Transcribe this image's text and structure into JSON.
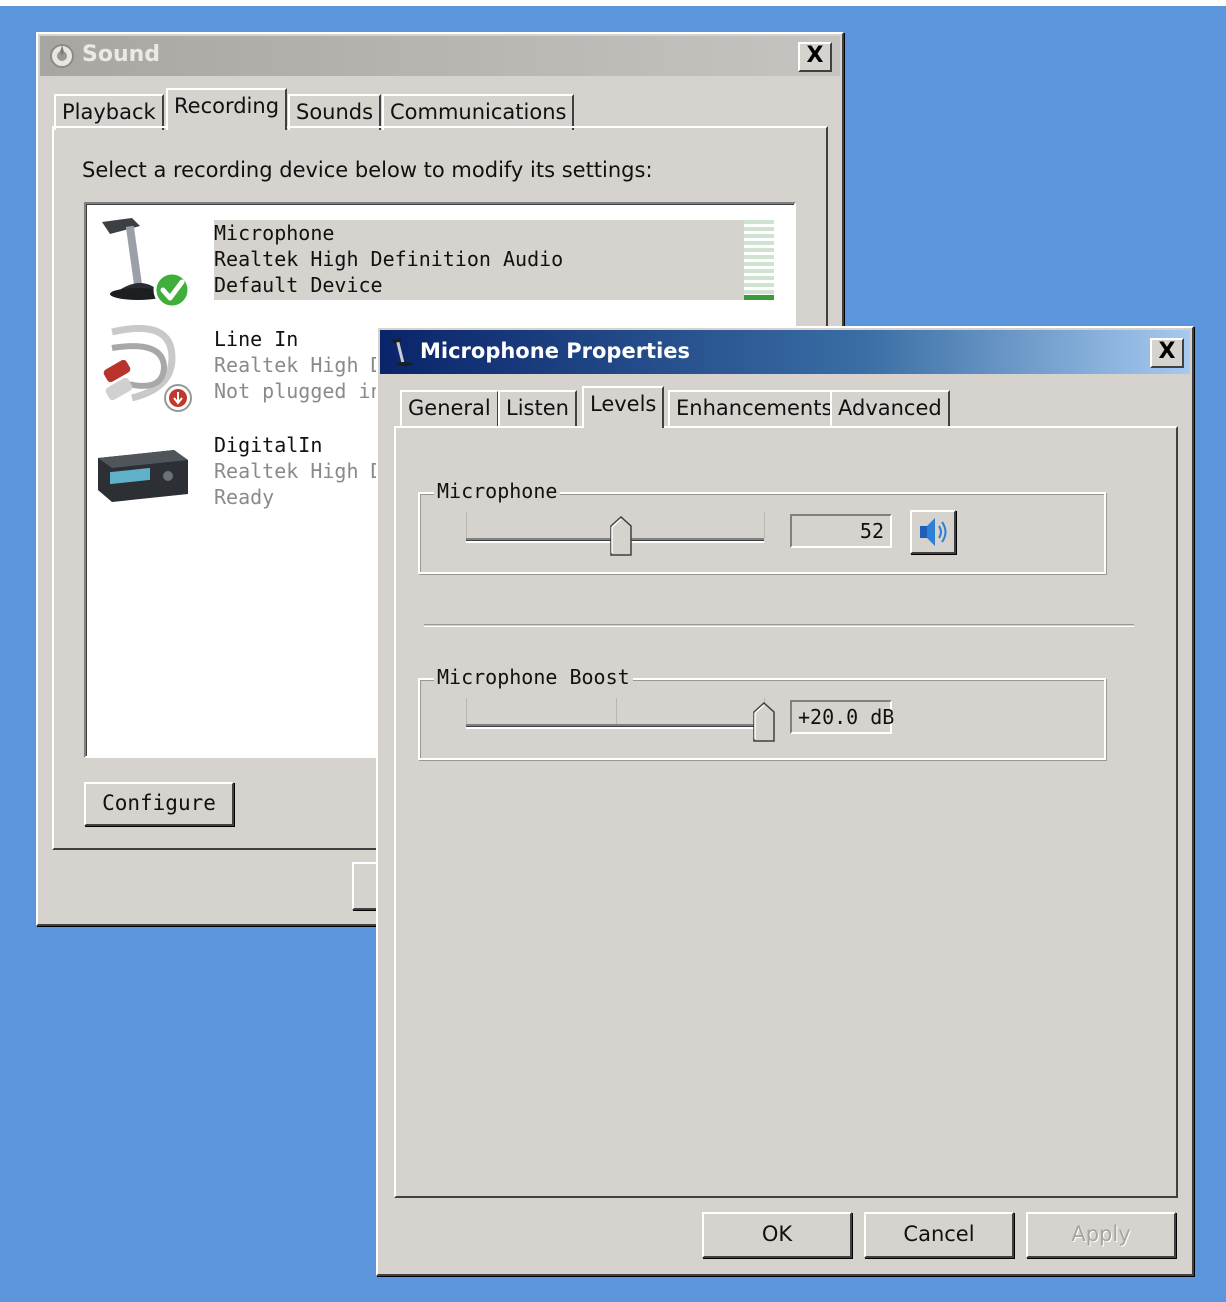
{
  "sound_window": {
    "title": "Sound",
    "close_label": "X",
    "tabs": [
      {
        "label": "Playback"
      },
      {
        "label": "Recording"
      },
      {
        "label": "Sounds"
      },
      {
        "label": "Communications"
      }
    ],
    "active_tab": "Recording",
    "instruction": "Select a recording device below to modify its settings:",
    "devices": [
      {
        "name": "Microphone",
        "driver": "Realtek High Definition Audio",
        "status": "Default Device",
        "icon": "microphone-icon",
        "selected": true
      },
      {
        "name": "Line In",
        "driver": "Realtek High De",
        "status": "Not plugged in",
        "icon": "line-in-cable-icon"
      },
      {
        "name": "DigitalIn",
        "driver": "Realtek High De",
        "status": "Ready",
        "icon": "digital-in-device-icon"
      }
    ],
    "configure_label": "Configure"
  },
  "mic_properties": {
    "title": "Microphone Properties",
    "close_label": "X",
    "tabs": [
      {
        "label": "General"
      },
      {
        "label": "Listen"
      },
      {
        "label": "Levels"
      },
      {
        "label": "Enhancements"
      },
      {
        "label": "Advanced"
      }
    ],
    "active_tab": "Levels",
    "microphone_group": {
      "label": "Microphone",
      "value": "52",
      "level_percent": 52,
      "mute_icon": "speaker-icon"
    },
    "boost_group": {
      "label": "Microphone Boost",
      "value": "+20.0 dB",
      "level_fraction": 1.0
    },
    "buttons": {
      "ok": "OK",
      "cancel": "Cancel",
      "apply": "Apply"
    }
  },
  "colors": {
    "desktop": "#5b95dc",
    "window_face": "#d6d3ce",
    "active_title_start": "#0a246a",
    "active_title_end": "#a6caf0",
    "default_check": "#3fae3a"
  }
}
